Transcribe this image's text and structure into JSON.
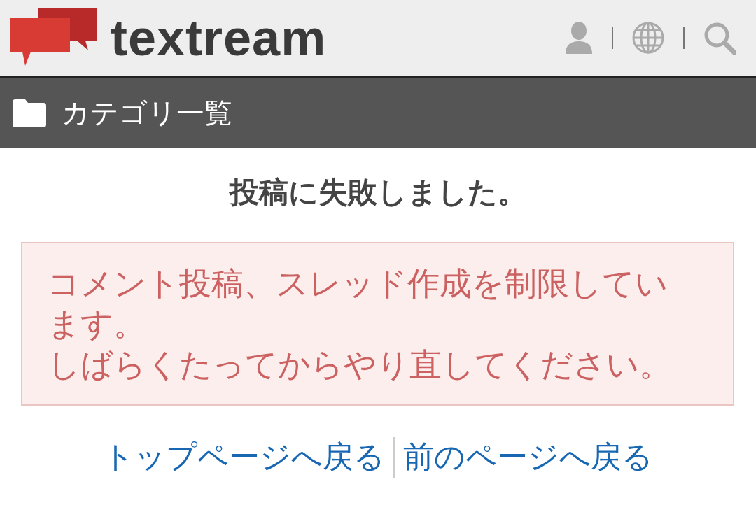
{
  "header": {
    "logo_text": "textream"
  },
  "category_bar": {
    "label": "カテゴリ一覧"
  },
  "title": "投稿に失敗しました。",
  "error": {
    "lines": [
      "コメント投稿、スレッド作成を制限しています。",
      "しばらくたってからやり直してください。"
    ]
  },
  "links": [
    "トップページへ戻る",
    "前のページへ戻る"
  ]
}
